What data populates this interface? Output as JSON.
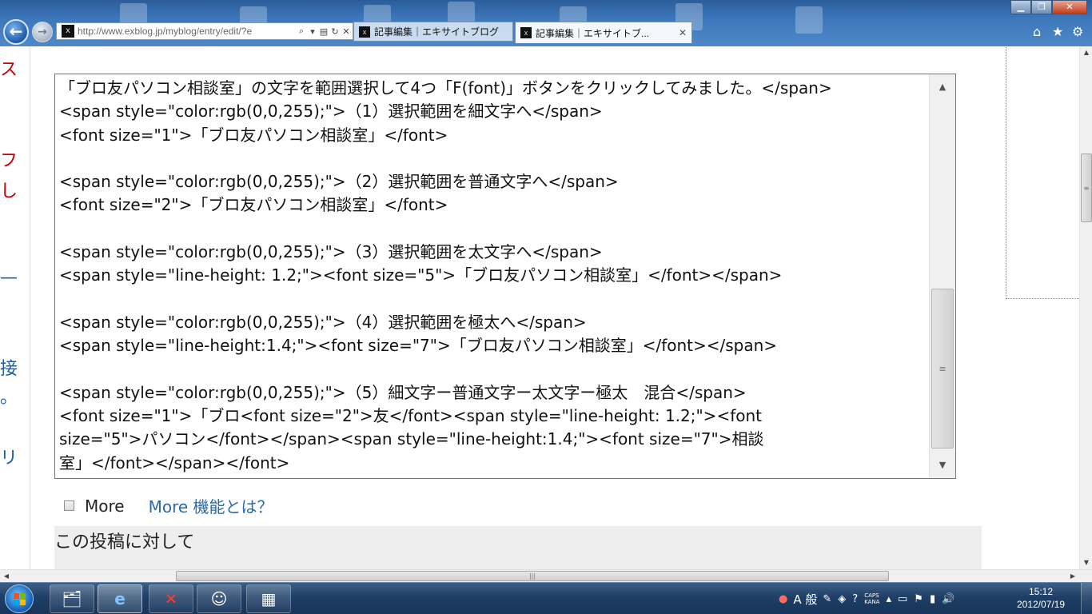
{
  "browser": {
    "address_url": "http://www.exblog.jp/myblog/entry/edit/?e",
    "tabs": [
      {
        "label": "記事編集｜エキサイトブログ",
        "active": false
      },
      {
        "label": "記事編集｜エキサイトブ...",
        "active": true
      }
    ],
    "icons": [
      "back-icon",
      "forward-icon",
      "search-icon",
      "compat-icon",
      "refresh-icon",
      "stop-icon",
      "home-icon",
      "star-icon",
      "gear-icon",
      "minimize-icon",
      "maximize-icon",
      "close-icon"
    ],
    "accent_color": "#3d77bb"
  },
  "sidebar_strip": {
    "fragments": [
      {
        "text": "ス",
        "color": "#cc0000"
      },
      {
        "text": "フ",
        "color": "#cc0000"
      },
      {
        "text": "し",
        "color": "#cc0000"
      },
      {
        "text": "—",
        "color": "#1a5fa8"
      },
      {
        "text": "接",
        "color": "#1a5fa8"
      },
      {
        "text": "。",
        "color": "#1a5fa8"
      },
      {
        "text": "リ",
        "color": "#1a5fa8"
      }
    ]
  },
  "editor": {
    "lines": [
      "「ブロ友パソコン相談室」の文字を範囲選択して4つ「F(font)」ボタンをクリックしてみました。</span>",
      "<span style=\"color:rgb(0,0,255);\">（1）選択範囲を細文字へ</span>",
      "<font size=\"1\">「ブロ友パソコン相談室」</font>",
      "",
      "<span style=\"color:rgb(0,0,255);\">（2）選択範囲を普通文字へ</span>",
      "<font size=\"2\">「ブロ友パソコン相談室」</font>",
      "",
      "<span style=\"color:rgb(0,0,255);\">（3）選択範囲を太文字へ</span>",
      "<span style=\"line-height: 1.2;\"><font size=\"5\">「ブロ友パソコン相談室」</font></span>",
      "",
      "<span style=\"color:rgb(0,0,255);\">（4）選択範囲を極太へ</span>",
      "<span style=\"line-height:1.4;\"><font size=\"7\">「ブロ友パソコン相談室」</font></span>",
      "",
      "<span style=\"color:rgb(0,0,255);\">（5）細文字ー普通文字ー太文字ー極太　混合</span>",
      "<font size=\"1\">「ブロ<font size=\"2\">友</font><span style=\"line-height: 1.2;\"><font",
      "size=\"5\">パソコン</font></span><span style=\"line-height:1.4;\"><font size=\"7\">相談",
      "室」</font></span></font>"
    ]
  },
  "more": {
    "checkbox_label": "More",
    "checked": false,
    "help_link": "More 機能とは？"
  },
  "post_section": {
    "heading": "この投稿に対して"
  },
  "taskbar": {
    "apps": [
      "explorer-icon",
      "ie-icon",
      "exblog-icon",
      "messenger-icon",
      "presentation-icon"
    ],
    "ime": "A 般",
    "caps": "CAPS",
    "kana": "KANA",
    "time": "15:12",
    "date": "2012/07/19"
  }
}
